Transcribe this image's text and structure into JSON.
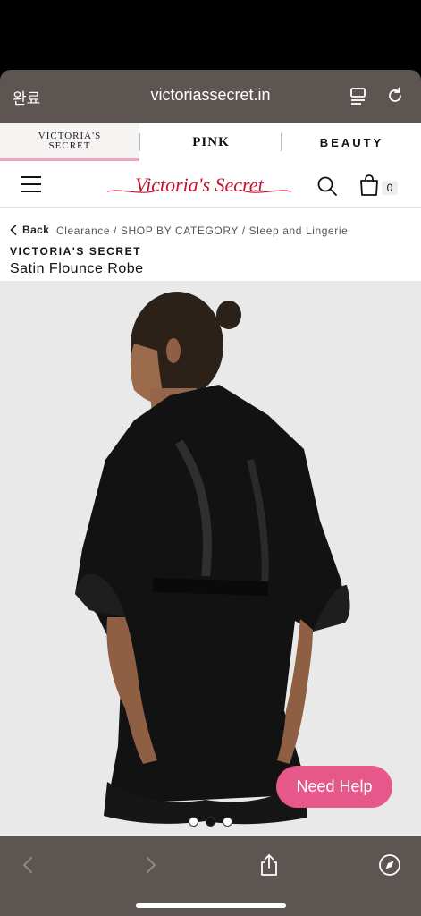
{
  "browser": {
    "done_label": "완료",
    "url": "victoriassecret.in",
    "tab_icon": "tabs-icon",
    "reload_icon": "reload-icon"
  },
  "brand_tabs": [
    {
      "label": "VICTORIA'S SECRET",
      "active": true
    },
    {
      "label": "PINK",
      "active": false
    },
    {
      "label": "BEAUTY",
      "active": false
    }
  ],
  "header": {
    "logo_text": "Victoria's Secret",
    "menu_icon": "hamburger-icon",
    "search_icon": "search-icon",
    "bag_icon": "shopping-bag-icon",
    "bag_count": "0",
    "brand_color": "#c8102e"
  },
  "breadcrumb": {
    "back_label": "Back",
    "path": "Clearance / SHOP BY CATEGORY / Sleep and Lingerie"
  },
  "product": {
    "brand": "VICTORIA'S SECRET",
    "title": "Satin Flounce Robe",
    "image_count": 3,
    "active_image": 2
  },
  "help_button": {
    "label": "Need Help",
    "color": "#e6578a"
  },
  "toolbar": {
    "back_icon": "chevron-left-icon",
    "forward_icon": "chevron-right-icon",
    "share_icon": "share-icon",
    "compass_icon": "compass-icon"
  }
}
